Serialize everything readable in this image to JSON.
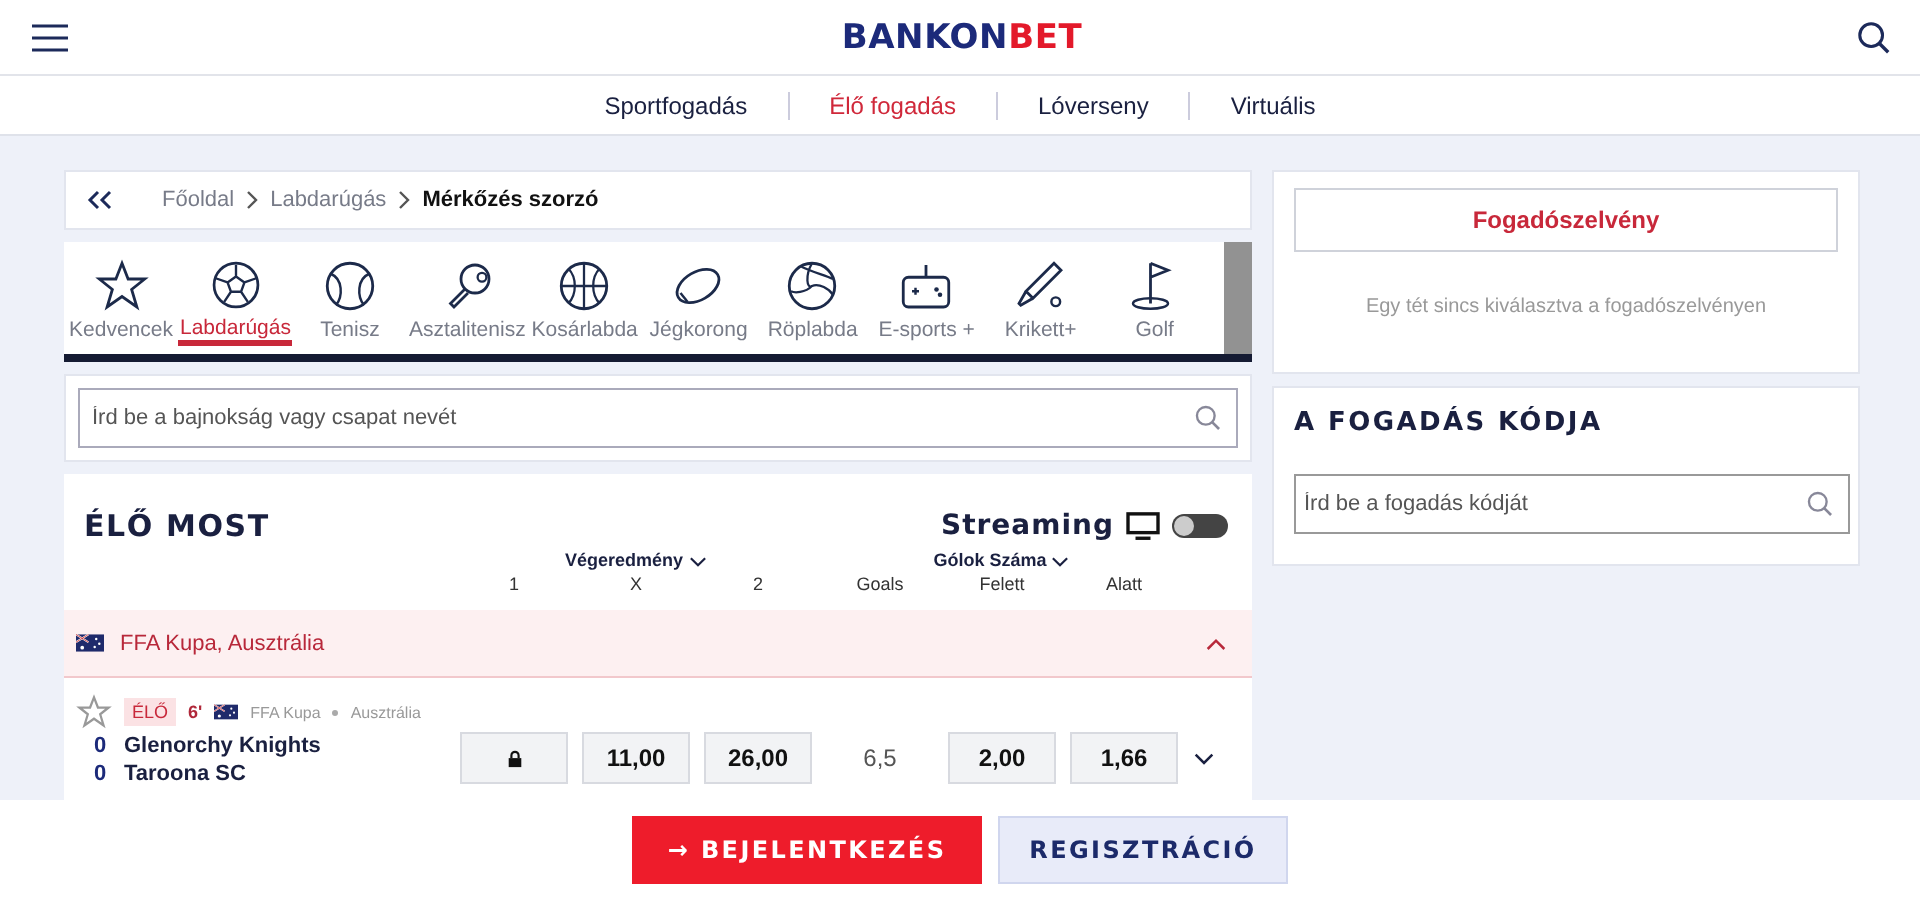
{
  "header": {
    "logo_left": "BANKON",
    "logo_right": "BET"
  },
  "nav": [
    {
      "label": "Sportfogadás",
      "selected": false
    },
    {
      "label": "Élő fogadás",
      "selected": true
    },
    {
      "label": "Lóverseny",
      "selected": false
    },
    {
      "label": "Virtuális",
      "selected": false
    }
  ],
  "breadcrumb": [
    "Főoldal",
    "Labdarúgás",
    "Mérkőzés szorzó"
  ],
  "sports": [
    {
      "label": "Kedvencek",
      "selected": false
    },
    {
      "label": "Labdarúgás",
      "selected": true
    },
    {
      "label": "Tenisz",
      "selected": false
    },
    {
      "label": "Asztalitenisz",
      "selected": false
    },
    {
      "label": "Kosárlabda",
      "selected": false
    },
    {
      "label": "Jégkorong",
      "selected": false
    },
    {
      "label": "Röplabda",
      "selected": false
    },
    {
      "label": "E-sports +",
      "selected": false
    },
    {
      "label": "Krikett+",
      "selected": false
    },
    {
      "label": "Golf",
      "selected": false
    }
  ],
  "search": {
    "placeholder": "Írd be a bajnokság vagy csapat nevét"
  },
  "live": {
    "title": "ÉLŐ MOST",
    "streaming": {
      "label": "Streaming",
      "on": false
    },
    "groups": [
      "Végeredmény",
      "Gólok Száma"
    ],
    "columns": [
      "1",
      "X",
      "2",
      "Goals",
      "Felett",
      "Alatt"
    ],
    "tournament": {
      "name": "FFA Kupa, Ausztrália",
      "expanded": true
    },
    "match": {
      "favorite": false,
      "badge": "ÉLŐ",
      "minute": "6'",
      "league": "FFA Kupa",
      "country": "Ausztrália",
      "expanded": false,
      "teams": [
        {
          "score": "0",
          "name": "Glenorchy Knights"
        },
        {
          "score": "0",
          "name": "Taroona SC"
        }
      ],
      "cells": [
        {
          "kind": "locked"
        },
        {
          "kind": "odd",
          "value": "11,00"
        },
        {
          "kind": "odd",
          "value": "26,00"
        },
        {
          "kind": "line",
          "value": "6,5"
        },
        {
          "kind": "odd",
          "value": "2,00"
        },
        {
          "kind": "odd",
          "value": "1,66"
        }
      ]
    }
  },
  "betslip": {
    "title": "Fogadószelvény",
    "empty_text": "Egy tét sincs kiválasztva a fogadószelvényen"
  },
  "bet_code": {
    "title": "A FOGADÁS KÓDJA",
    "placeholder": "Írd be a fogadás kódját"
  },
  "footer": {
    "login": "BEJELENTKEZÉS",
    "login_arrow": "→",
    "register": "REGISZTRÁCIÓ"
  }
}
